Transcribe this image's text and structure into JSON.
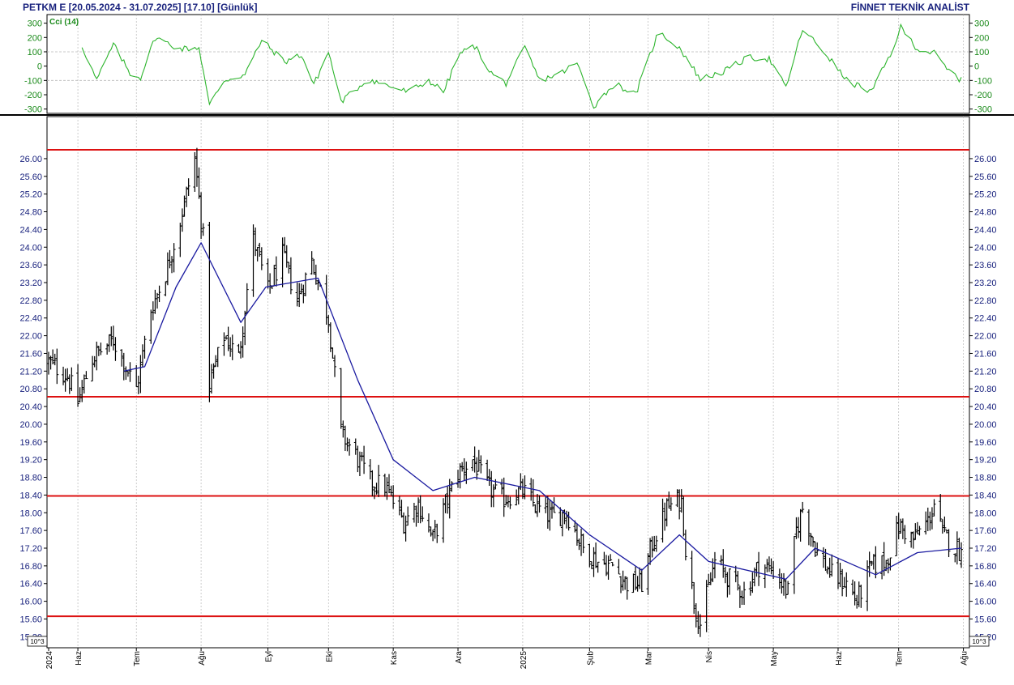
{
  "header": {
    "left": "PETKM E  [20.05.2024 - 31.07.2025]  [17.10]  [Günlük]",
    "right": "FİNNET TEKNİK ANALİST"
  },
  "indicator": {
    "label": "Cci (14)",
    "color": "#2db52d",
    "ticks": [
      "300",
      "200",
      "100",
      "0",
      "-100",
      "-200",
      "-300"
    ],
    "tick_values": [
      300,
      200,
      100,
      0,
      -100,
      -200,
      -300
    ],
    "ylim": [
      -330,
      360
    ]
  },
  "price_axis": {
    "ticks": [
      "26.00",
      "25.60",
      "25.20",
      "24.80",
      "24.40",
      "24.00",
      "23.60",
      "23.20",
      "22.80",
      "22.40",
      "22.00",
      "21.60",
      "21.20",
      "20.80",
      "20.40",
      "20.00",
      "19.60",
      "19.20",
      "18.80",
      "18.40",
      "18.00",
      "17.60",
      "17.20",
      "16.80",
      "16.40",
      "16.00",
      "15.60",
      "15.20"
    ],
    "tick_values": [
      26.0,
      25.6,
      25.2,
      24.8,
      24.4,
      24.0,
      23.6,
      23.2,
      22.8,
      22.4,
      22.0,
      21.6,
      21.2,
      20.8,
      20.4,
      20.0,
      19.6,
      19.2,
      18.8,
      18.4,
      18.0,
      17.6,
      17.2,
      16.8,
      16.4,
      16.0,
      15.6,
      15.2
    ],
    "ylim": [
      14.95,
      26.95
    ],
    "scale_label": "10^3"
  },
  "x_axis": {
    "labels": [
      "2024",
      "Haz",
      "Tem",
      "Ağu",
      "Eyl",
      "Eki",
      "Kas",
      "Ara",
      "2025",
      "Şub",
      "Mar",
      "Nis",
      "May",
      "Haz",
      "Tem",
      "Ağu"
    ]
  },
  "colors": {
    "bars": "#000000",
    "ma": "#1a1aa0",
    "levels": "#dd1111",
    "cci": "#2db52d",
    "grid": "#b8b8b8",
    "axis_text": "#1a237e"
  },
  "chart_data": {
    "type": "ohlc",
    "title": "PETKM E [20.05.2024 - 31.07.2025] [17.10] [Günlük]",
    "x_range": [
      "2024-05-20",
      "2025-07-31"
    ],
    "last_close": 17.1,
    "support_resistance_levels": [
      26.2,
      20.62,
      18.38,
      15.66
    ],
    "price_anchors": [
      {
        "date": "2024-05-20",
        "close": 21.4
      },
      {
        "date": "2024-05-29",
        "close": 21.1
      },
      {
        "date": "2024-06-03",
        "close": 20.5
      },
      {
        "date": "2024-06-10",
        "close": 21.5
      },
      {
        "date": "2024-06-20",
        "close": 21.9
      },
      {
        "date": "2024-07-01",
        "close": 20.8
      },
      {
        "date": "2024-07-08",
        "close": 22.6
      },
      {
        "date": "2024-07-15",
        "close": 23.4
      },
      {
        "date": "2024-07-22",
        "close": 24.6
      },
      {
        "date": "2024-07-29",
        "close": 26.0
      },
      {
        "date": "2024-08-02",
        "close": 24.2
      },
      {
        "date": "2024-08-05",
        "close": 20.9
      },
      {
        "date": "2024-08-12",
        "close": 22.0
      },
      {
        "date": "2024-08-19",
        "close": 21.5
      },
      {
        "date": "2024-08-26",
        "close": 24.2
      },
      {
        "date": "2024-09-02",
        "close": 23.0
      },
      {
        "date": "2024-09-09",
        "close": 23.8
      },
      {
        "date": "2024-09-16",
        "close": 22.8
      },
      {
        "date": "2024-09-23",
        "close": 23.7
      },
      {
        "date": "2024-10-01",
        "close": 22.4
      },
      {
        "date": "2024-10-07",
        "close": 19.8
      },
      {
        "date": "2024-10-14",
        "close": 19.3
      },
      {
        "date": "2024-10-21",
        "close": 18.7
      },
      {
        "date": "2024-10-28",
        "close": 18.6
      },
      {
        "date": "2024-11-06",
        "close": 17.8
      },
      {
        "date": "2024-11-13",
        "close": 18.2
      },
      {
        "date": "2024-11-20",
        "close": 17.4
      },
      {
        "date": "2024-11-27",
        "close": 18.3
      },
      {
        "date": "2024-12-02",
        "close": 18.9
      },
      {
        "date": "2024-12-09",
        "close": 19.2
      },
      {
        "date": "2024-12-16",
        "close": 18.6
      },
      {
        "date": "2024-12-23",
        "close": 18.3
      },
      {
        "date": "2025-01-02",
        "close": 18.5
      },
      {
        "date": "2025-01-09",
        "close": 18.1
      },
      {
        "date": "2025-01-16",
        "close": 17.9
      },
      {
        "date": "2025-01-23",
        "close": 18.0
      },
      {
        "date": "2025-01-31",
        "close": 17.2
      },
      {
        "date": "2025-02-07",
        "close": 16.9
      },
      {
        "date": "2025-02-14",
        "close": 16.8
      },
      {
        "date": "2025-02-21",
        "close": 16.4
      },
      {
        "date": "2025-02-28",
        "close": 16.4
      },
      {
        "date": "2025-03-05",
        "close": 17.3
      },
      {
        "date": "2025-03-12",
        "close": 18.1
      },
      {
        "date": "2025-03-19",
        "close": 18.3
      },
      {
        "date": "2025-03-21",
        "close": 17.2
      },
      {
        "date": "2025-03-25",
        "close": 16.0
      },
      {
        "date": "2025-03-28",
        "close": 15.5
      },
      {
        "date": "2025-04-04",
        "close": 16.9
      },
      {
        "date": "2025-04-11",
        "close": 16.5
      },
      {
        "date": "2025-04-18",
        "close": 16.2
      },
      {
        "date": "2025-04-25",
        "close": 16.8
      },
      {
        "date": "2025-05-02",
        "close": 16.7
      },
      {
        "date": "2025-05-09",
        "close": 16.2
      },
      {
        "date": "2025-05-13",
        "close": 17.6
      },
      {
        "date": "2025-05-16",
        "close": 18.1
      },
      {
        "date": "2025-05-23",
        "close": 17.1
      },
      {
        "date": "2025-05-30",
        "close": 16.6
      },
      {
        "date": "2025-06-06",
        "close": 16.4
      },
      {
        "date": "2025-06-11",
        "close": 16.0
      },
      {
        "date": "2025-06-18",
        "close": 16.8
      },
      {
        "date": "2025-06-25",
        "close": 16.9
      },
      {
        "date": "2025-07-01",
        "close": 17.7
      },
      {
        "date": "2025-07-08",
        "close": 17.4
      },
      {
        "date": "2025-07-15",
        "close": 17.8
      },
      {
        "date": "2025-07-18",
        "close": 18.2
      },
      {
        "date": "2025-07-22",
        "close": 17.5
      },
      {
        "date": "2025-07-31",
        "close": 17.1
      }
    ],
    "moving_average_anchors": [
      {
        "date": "2024-06-25",
        "value": 21.2
      },
      {
        "date": "2024-07-05",
        "value": 21.3
      },
      {
        "date": "2024-07-20",
        "value": 23.1
      },
      {
        "date": "2024-08-01",
        "value": 24.1
      },
      {
        "date": "2024-08-20",
        "value": 22.3
      },
      {
        "date": "2024-09-01",
        "value": 23.1
      },
      {
        "date": "2024-09-26",
        "value": 23.3
      },
      {
        "date": "2024-10-15",
        "value": 21.0
      },
      {
        "date": "2024-11-01",
        "value": 19.2
      },
      {
        "date": "2024-11-20",
        "value": 18.5
      },
      {
        "date": "2024-12-10",
        "value": 18.8
      },
      {
        "date": "2025-01-10",
        "value": 18.5
      },
      {
        "date": "2025-02-03",
        "value": 17.5
      },
      {
        "date": "2025-02-28",
        "value": 16.7
      },
      {
        "date": "2025-03-18",
        "value": 17.5
      },
      {
        "date": "2025-04-01",
        "value": 16.9
      },
      {
        "date": "2025-05-08",
        "value": 16.5
      },
      {
        "date": "2025-05-22",
        "value": 17.2
      },
      {
        "date": "2025-06-20",
        "value": 16.6
      },
      {
        "date": "2025-07-10",
        "value": 17.1
      },
      {
        "date": "2025-07-31",
        "value": 17.2
      }
    ],
    "cci_anchors": [
      {
        "date": "2024-06-05",
        "value": 140
      },
      {
        "date": "2024-06-12",
        "value": -100
      },
      {
        "date": "2024-06-20",
        "value": 150
      },
      {
        "date": "2024-06-28",
        "value": -50
      },
      {
        "date": "2024-07-03",
        "value": -80
      },
      {
        "date": "2024-07-10",
        "value": 200
      },
      {
        "date": "2024-07-22",
        "value": 120
      },
      {
        "date": "2024-07-31",
        "value": 130
      },
      {
        "date": "2024-08-05",
        "value": -270
      },
      {
        "date": "2024-08-12",
        "value": -100
      },
      {
        "date": "2024-08-22",
        "value": -60
      },
      {
        "date": "2024-08-30",
        "value": 180
      },
      {
        "date": "2024-09-10",
        "value": 30
      },
      {
        "date": "2024-09-18",
        "value": 80
      },
      {
        "date": "2024-09-24",
        "value": -130
      },
      {
        "date": "2024-10-01",
        "value": 100
      },
      {
        "date": "2024-10-07",
        "value": -250
      },
      {
        "date": "2024-10-20",
        "value": -90
      },
      {
        "date": "2024-11-01",
        "value": -150
      },
      {
        "date": "2024-11-08",
        "value": -180
      },
      {
        "date": "2024-11-18",
        "value": -100
      },
      {
        "date": "2024-11-25",
        "value": -180
      },
      {
        "date": "2024-12-03",
        "value": 90
      },
      {
        "date": "2024-12-10",
        "value": 140
      },
      {
        "date": "2024-12-18",
        "value": -50
      },
      {
        "date": "2024-12-25",
        "value": -120
      },
      {
        "date": "2025-01-03",
        "value": 130
      },
      {
        "date": "2025-01-10",
        "value": -100
      },
      {
        "date": "2025-01-20",
        "value": -50
      },
      {
        "date": "2025-01-28",
        "value": 20
      },
      {
        "date": "2025-02-05",
        "value": -280
      },
      {
        "date": "2025-02-15",
        "value": -120
      },
      {
        "date": "2025-02-25",
        "value": -200
      },
      {
        "date": "2025-03-08",
        "value": 240
      },
      {
        "date": "2025-03-18",
        "value": 130
      },
      {
        "date": "2025-03-28",
        "value": -90
      },
      {
        "date": "2025-04-08",
        "value": -40
      },
      {
        "date": "2025-04-20",
        "value": 60
      },
      {
        "date": "2025-04-30",
        "value": 50
      },
      {
        "date": "2025-05-08",
        "value": -150
      },
      {
        "date": "2025-05-16",
        "value": 260
      },
      {
        "date": "2025-05-28",
        "value": 70
      },
      {
        "date": "2025-06-06",
        "value": -100
      },
      {
        "date": "2025-06-18",
        "value": -180
      },
      {
        "date": "2025-06-27",
        "value": 80
      },
      {
        "date": "2025-07-02",
        "value": 270
      },
      {
        "date": "2025-07-10",
        "value": 120
      },
      {
        "date": "2025-07-18",
        "value": 90
      },
      {
        "date": "2025-07-24",
        "value": -20
      },
      {
        "date": "2025-07-31",
        "value": -100
      }
    ]
  }
}
